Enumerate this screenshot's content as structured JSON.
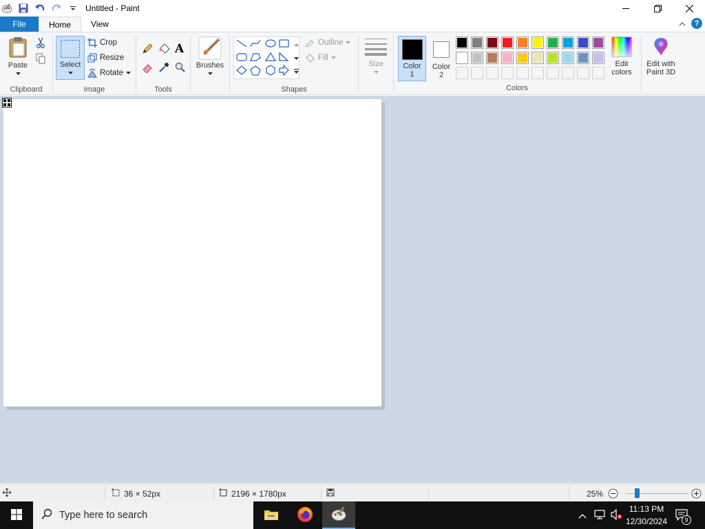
{
  "window": {
    "title": "Untitled - Paint",
    "controls": {
      "minimize": "minimize-icon",
      "maximize": "maximize-icon",
      "close": "close-icon"
    }
  },
  "menu": {
    "file": "File",
    "tabs": [
      "Home",
      "View"
    ],
    "active_tab": "Home"
  },
  "ribbon": {
    "clipboard": {
      "label": "Clipboard",
      "paste": "Paste"
    },
    "image": {
      "label": "Image",
      "select": "Select",
      "crop": "Crop",
      "resize": "Resize",
      "rotate": "Rotate"
    },
    "tools": {
      "label": "Tools"
    },
    "brushes": "Brushes",
    "shapes": {
      "label": "Shapes",
      "outline": "Outline",
      "fill": "Fill"
    },
    "size": "Size",
    "color1": {
      "label": "Color",
      "num": "1",
      "value": "#000000"
    },
    "color2": {
      "label": "Color",
      "num": "2",
      "value": "#ffffff"
    },
    "colors": {
      "label": "Colors",
      "row1": [
        "#000000",
        "#7f7f7f",
        "#880015",
        "#ed1c24",
        "#ff7f27",
        "#fff200",
        "#22b14c",
        "#00a2e8",
        "#3f48cc",
        "#a349a4"
      ],
      "row2": [
        "#ffffff",
        "#c3c3c3",
        "#b97a57",
        "#ffaec9",
        "#ffc90e",
        "#efe4b0",
        "#b5e61d",
        "#99d9ea",
        "#7092be",
        "#c8bfe7"
      ]
    },
    "edit_colors": {
      "line1": "Edit",
      "line2": "colors"
    },
    "paint3d": {
      "line1": "Edit with",
      "line2": "Paint 3D"
    }
  },
  "status": {
    "selection_size": "36 × 52px",
    "image_size": "2196 × 1780px",
    "zoom": "25%",
    "zoom_level": 0.25
  },
  "taskbar": {
    "search_placeholder": "Type here to search",
    "time": "11:13 PM",
    "date": "12/30/2024",
    "notification_count": "9"
  }
}
